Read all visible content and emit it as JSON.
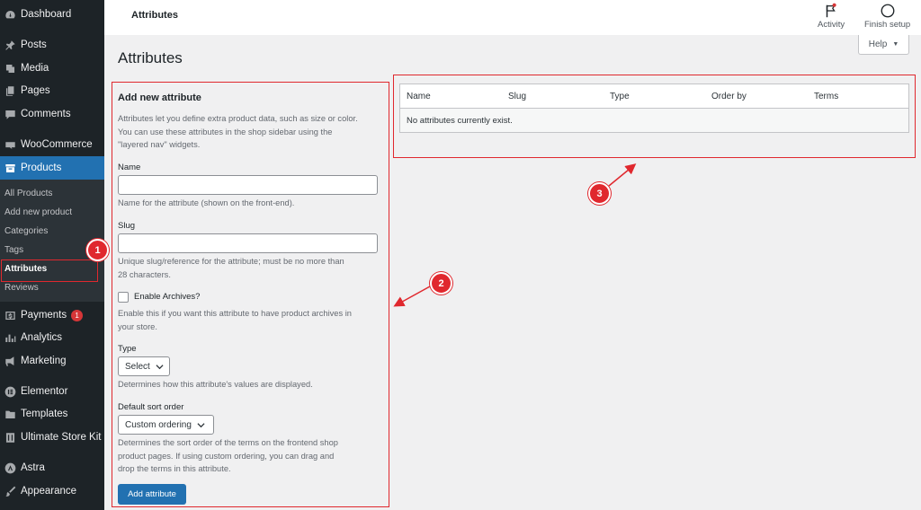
{
  "sidebar": {
    "items": [
      {
        "label": "Dashboard",
        "icon": "dashboard-icon"
      },
      {
        "label": "Posts",
        "icon": "pin-icon"
      },
      {
        "label": "Media",
        "icon": "media-icon"
      },
      {
        "label": "Pages",
        "icon": "pages-icon"
      },
      {
        "label": "Comments",
        "icon": "comment-icon"
      },
      {
        "label": "WooCommerce",
        "icon": "woocommerce-icon"
      },
      {
        "label": "Products",
        "icon": "archive-icon"
      },
      {
        "label": "Payments",
        "icon": "payments-icon",
        "badge": "1"
      },
      {
        "label": "Analytics",
        "icon": "chart-bar-icon"
      },
      {
        "label": "Marketing",
        "icon": "megaphone-icon"
      },
      {
        "label": "Elementor",
        "icon": "elementor-icon"
      },
      {
        "label": "Templates",
        "icon": "folder-icon"
      },
      {
        "label": "Ultimate Store Kit",
        "icon": "store-kit-icon"
      },
      {
        "label": "Astra",
        "icon": "astra-icon"
      },
      {
        "label": "Appearance",
        "icon": "brush-icon"
      }
    ],
    "submenu": [
      "All Products",
      "Add new product",
      "Categories",
      "Tags",
      "Attributes",
      "Reviews"
    ]
  },
  "topbar": {
    "title": "Attributes",
    "activity_label": "Activity",
    "finish_setup_label": "Finish setup"
  },
  "help_label": "Help",
  "page_title": "Attributes",
  "form": {
    "heading": "Add new attribute",
    "intro_lines": [
      "Attributes let you define extra product data, such as size or color.",
      "You can use these attributes in the shop sidebar using the",
      "\"layered nav\" widgets."
    ],
    "name_label": "Name",
    "name_value": "",
    "name_desc": "Name for the attribute (shown on the front-end).",
    "slug_label": "Slug",
    "slug_value": "",
    "slug_desc_lines": [
      "Unique slug/reference for the attribute; must be no more than",
      "28 characters."
    ],
    "archives_label": "Enable Archives?",
    "archives_checked": false,
    "archives_desc_lines": [
      "Enable this if you want this attribute to have product archives in",
      "your store."
    ],
    "type_label": "Type",
    "type_value": "Select",
    "type_desc": "Determines how this attribute's values are displayed.",
    "sort_label": "Default sort order",
    "sort_value": "Custom ordering",
    "sort_desc_lines": [
      "Determines the sort order of the terms on the frontend shop",
      "product pages. If using custom ordering, you can drag and",
      "drop the terms in this attribute."
    ],
    "submit_label": "Add attribute"
  },
  "table": {
    "columns": [
      "Name",
      "Slug",
      "Type",
      "Order by",
      "Terms"
    ],
    "empty_message": "No attributes currently exist."
  },
  "callouts": [
    "1",
    "2",
    "3"
  ],
  "colors": {
    "accent": "#2271b1",
    "annotation": "#e0282e",
    "sidebar_bg": "#1d2327"
  }
}
